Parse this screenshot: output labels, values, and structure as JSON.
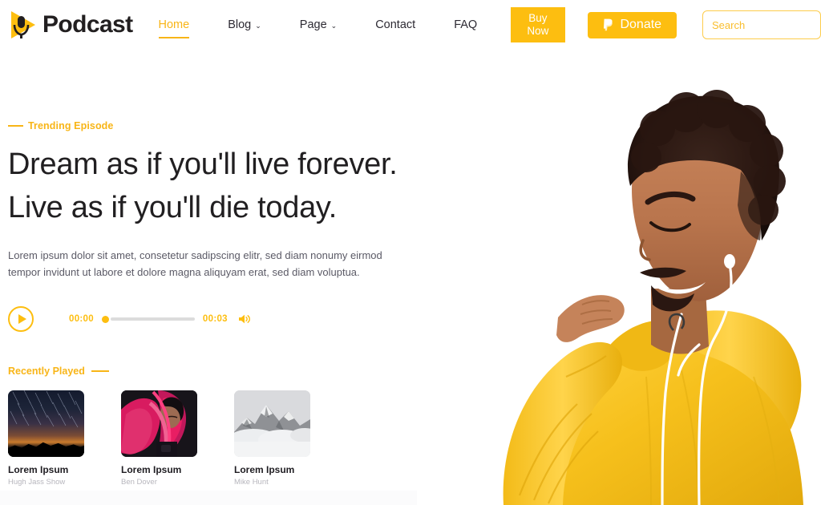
{
  "header": {
    "brand": {
      "name": "Podcast",
      "logo_icon": "microphone-play-logo"
    },
    "nav": [
      {
        "label": "Home",
        "active": true,
        "has_caret": false
      },
      {
        "label": "Blog",
        "active": false,
        "has_caret": true
      },
      {
        "label": "Page",
        "active": false,
        "has_caret": true
      },
      {
        "label": "Contact",
        "active": false,
        "has_caret": false
      },
      {
        "label": "FAQ",
        "active": false,
        "has_caret": false
      }
    ],
    "buy_now_label": "Buy Now",
    "donate_label": "Donate",
    "donate_icon": "paypal-icon",
    "search": {
      "placeholder": "Search",
      "value": "",
      "icon": "search-icon"
    }
  },
  "hero": {
    "eyebrow": "Trending Episode",
    "title_line1": "Dream as if you'll live forever.",
    "title_line2": "Live as if you'll die today.",
    "description": "Lorem ipsum dolor sit amet, consetetur sadipscing elitr, sed diam nonumy eirmod tempor invidunt ut labore et dolore magna aliquyam erat, sed diam voluptua.",
    "image_alt": "smiling-man-yellow-hoodie-earphones"
  },
  "player": {
    "play_icon": "play-icon",
    "current_time": "00:00",
    "total_time": "00:03",
    "progress_percent": 0,
    "volume_icon": "volume-icon"
  },
  "recently_played": {
    "heading": "Recently Played",
    "cards": [
      {
        "title": "Lorem Ipsum",
        "author": "Hugh Jass Show",
        "thumb": "night-sky-star-trails"
      },
      {
        "title": "Lorem Ipsum",
        "author": "Ben Dover",
        "thumb": "woman-pink-jacket"
      },
      {
        "title": "Lorem Ipsum",
        "author": "Mike Hunt",
        "thumb": "grayscale-mountain-clouds"
      }
    ]
  },
  "colors": {
    "accent": "#FDBE10",
    "accent_text": "#F8B517",
    "dark_text": "#211F21",
    "body_text": "#5B5A66",
    "muted_text": "#B7B6BD",
    "hoodie_yellow": "#F5C020"
  }
}
